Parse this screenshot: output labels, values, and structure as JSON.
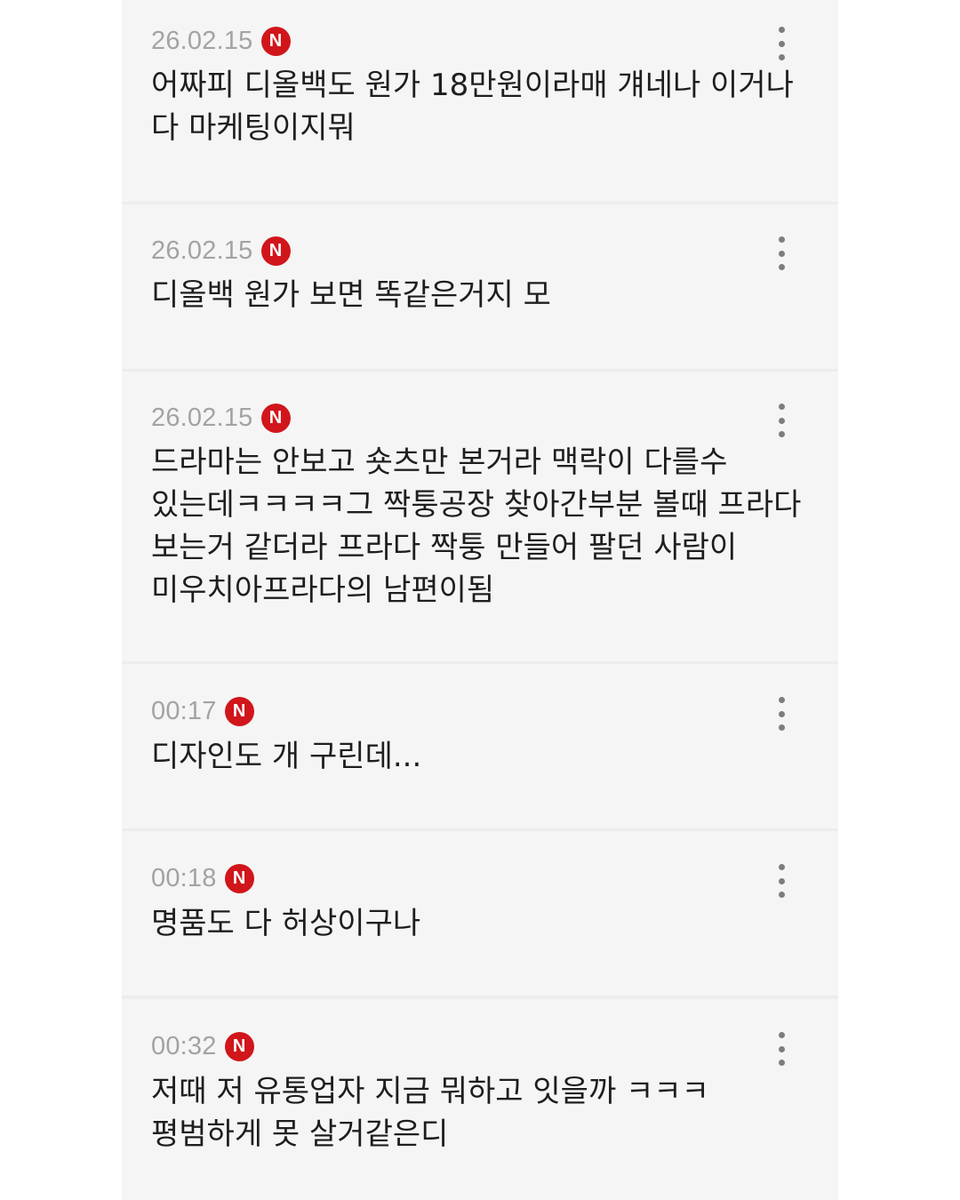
{
  "comments": [
    {
      "time": "26.02.15",
      "badge": "N",
      "text": "어짜피 디올백도 원가 18만원이라매 걔네나 이거나 다 마케팅이지뭐",
      "menu_icon": "more-vertical-icon"
    },
    {
      "time": "26.02.15",
      "badge": "N",
      "text": "디올백 원가 보면 똑같은거지 모",
      "menu_icon": "more-vertical-icon"
    },
    {
      "time": "26.02.15",
      "badge": "N",
      "text": "드라마는 안보고 숏츠만 본거라 맥락이 다를수 있는데ㅋㅋㅋㅋ그 짝퉁공장 찾아간부분 볼때 프라다 보는거 같더라 프라다 짝퉁 만들어 팔던 사람이 미우치아프라다의 남편이됨",
      "menu_icon": "more-vertical-icon"
    },
    {
      "time": "00:17",
      "badge": "N",
      "text": "디자인도 개 구린데...",
      "menu_icon": "more-vertical-icon"
    },
    {
      "time": "00:18",
      "badge": "N",
      "text": "명품도 다 허상이구나",
      "menu_icon": "more-vertical-icon"
    },
    {
      "time": "00:32",
      "badge": "N",
      "text": "저때 저 유통업자 지금 뭐하고 잇을까 ㅋㅋㅋ 평범하게 못 살거같은디",
      "menu_icon": "more-vertical-icon"
    }
  ],
  "colors": {
    "badge": "#d0161b",
    "timestamp": "#a3a3a3",
    "text": "#1e1e1e",
    "card_background": "#f5f5f5",
    "divider": "#ededed"
  }
}
